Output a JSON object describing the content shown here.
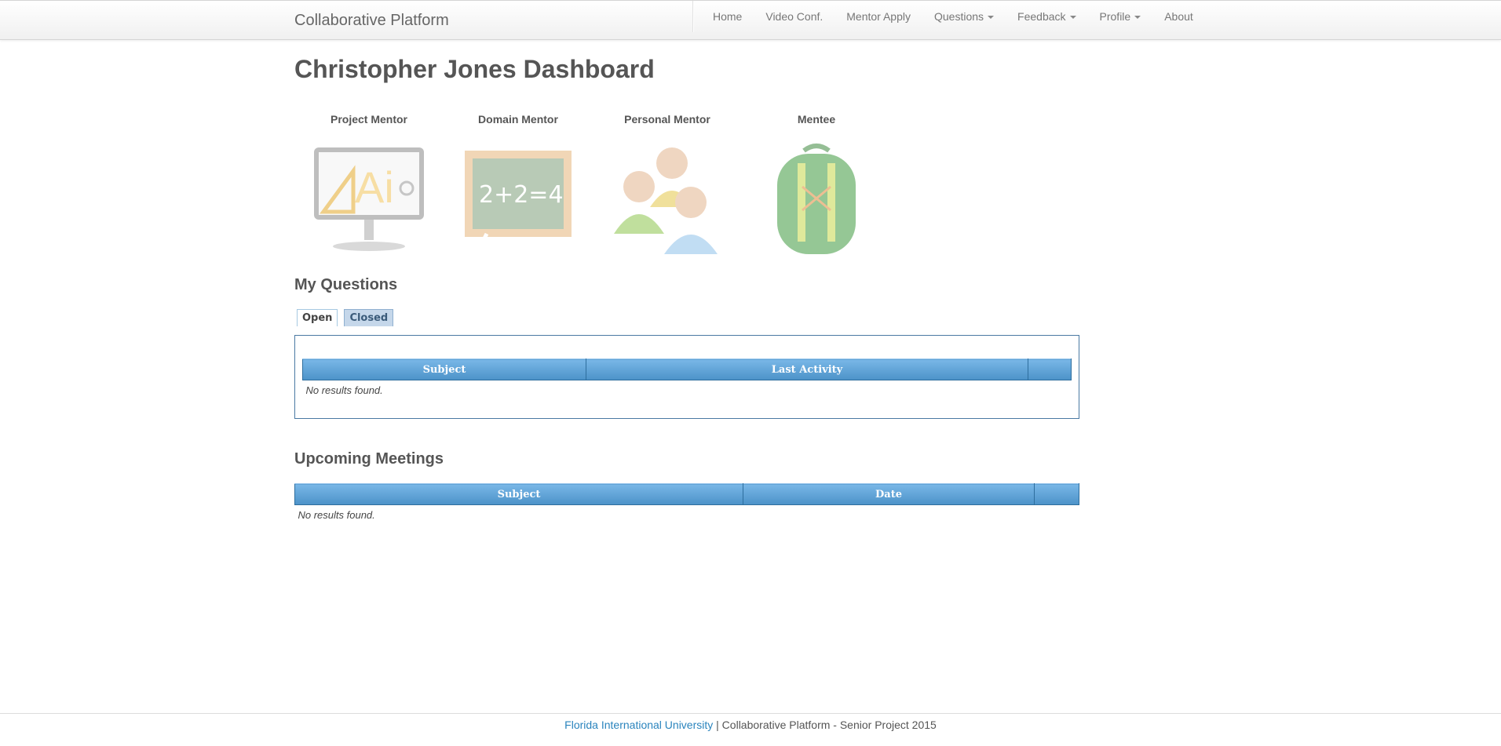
{
  "navbar": {
    "brand": "Collaborative Platform",
    "items": [
      {
        "label": "Home",
        "dropdown": false
      },
      {
        "label": "Video Conf.",
        "dropdown": false
      },
      {
        "label": "Mentor Apply",
        "dropdown": false
      },
      {
        "label": "Questions",
        "dropdown": true
      },
      {
        "label": "Feedback",
        "dropdown": true
      },
      {
        "label": "Profile",
        "dropdown": true
      },
      {
        "label": "About",
        "dropdown": false
      }
    ]
  },
  "page": {
    "title": "Christopher Jones Dashboard"
  },
  "roles": [
    {
      "label": "Project Mentor",
      "icon": "presentation-board-icon"
    },
    {
      "label": "Domain Mentor",
      "icon": "chalkboard-icon"
    },
    {
      "label": "Personal Mentor",
      "icon": "people-group-icon"
    },
    {
      "label": "Mentee",
      "icon": "backpack-icon"
    }
  ],
  "my_questions": {
    "title": "My Questions",
    "tabs": [
      "Open",
      "Closed"
    ],
    "active_tab": "Open",
    "columns": [
      "Subject",
      "Last Activity",
      ""
    ],
    "empty_text": "No results found."
  },
  "meetings": {
    "title": "Upcoming Meetings",
    "columns": [
      "Subject",
      "Date",
      ""
    ],
    "empty_text": "No results found."
  },
  "footer": {
    "link": "Florida International University",
    "text": " | Collaborative Platform - Senior Project 2015"
  },
  "colors": {
    "grid_header": "#4c92c8",
    "link": "#2a84bd",
    "panel_border": "#4a79a3"
  }
}
